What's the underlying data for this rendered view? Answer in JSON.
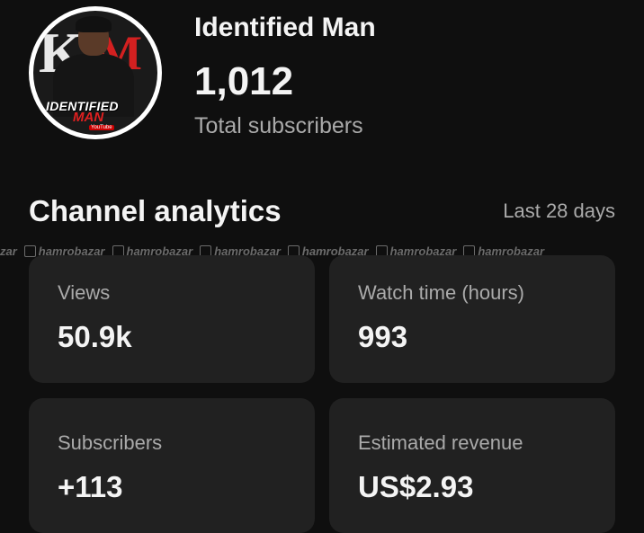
{
  "channel": {
    "name": "Identified Man",
    "subscriber_count": "1,012",
    "subscriber_label": "Total subscribers",
    "avatar": {
      "icon": "channel-avatar-logo",
      "logo_text_1": "IDENTIFIED",
      "logo_text_2": "MAN",
      "logo_text_3": "YouTube"
    }
  },
  "analytics": {
    "title": "Channel analytics",
    "range": "Last 28 days",
    "cards": [
      {
        "label": "Views",
        "value": "50.9k"
      },
      {
        "label": "Watch time (hours)",
        "value": "993"
      },
      {
        "label": "Subscribers",
        "value": "+113"
      },
      {
        "label": "Estimated revenue",
        "value": "US$2.93"
      }
    ]
  },
  "watermark": {
    "text": "hamrobazar",
    "partial_text": "zar"
  },
  "colors": {
    "background": "#0f0f0f",
    "card": "#212121",
    "primary_text": "#f4f4f4",
    "secondary_text": "#aaaaaa",
    "logo_red": "#d32020"
  }
}
